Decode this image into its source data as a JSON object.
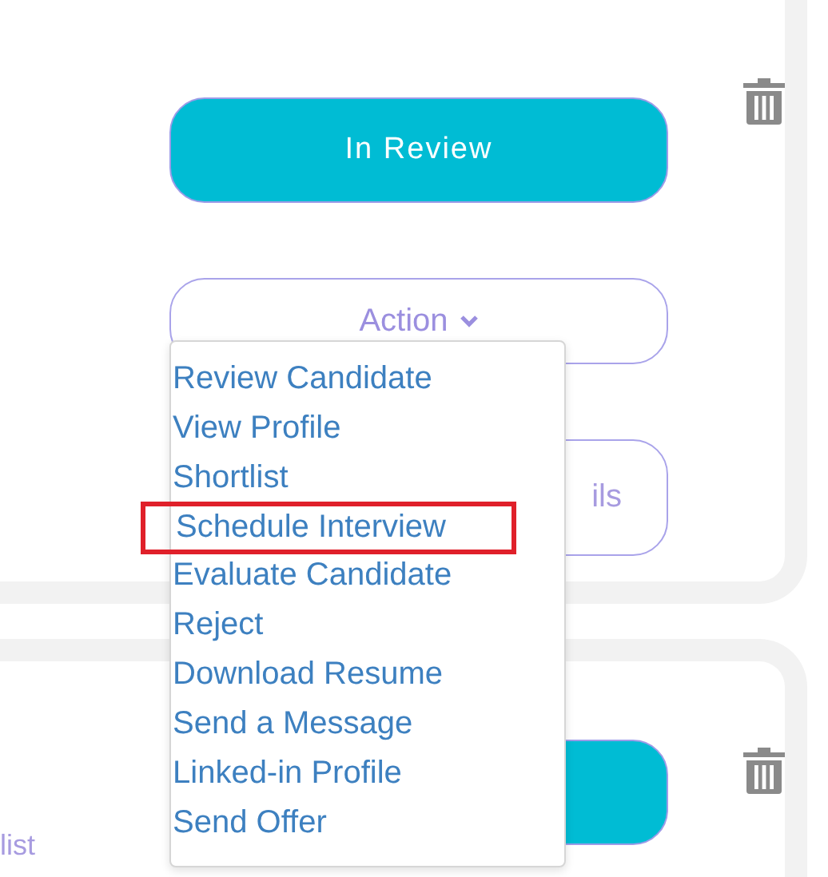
{
  "first_card": {
    "status_button": "In Review",
    "action_button": "Action",
    "details_button": "ils"
  },
  "second_card": {
    "side_text": "list"
  },
  "action_menu": {
    "items": [
      {
        "label": "Review Candidate",
        "highlighted": false
      },
      {
        "label": "View Profile",
        "highlighted": false
      },
      {
        "label": "Shortlist",
        "highlighted": false
      },
      {
        "label": "Schedule Interview",
        "highlighted": true
      },
      {
        "label": "Evaluate Candidate",
        "highlighted": false
      },
      {
        "label": "Reject",
        "highlighted": false
      },
      {
        "label": "Download Resume",
        "highlighted": false
      },
      {
        "label": "Send a Message",
        "highlighted": false
      },
      {
        "label": "Linked-in Profile",
        "highlighted": false
      },
      {
        "label": "Send Offer",
        "highlighted": false
      }
    ]
  }
}
